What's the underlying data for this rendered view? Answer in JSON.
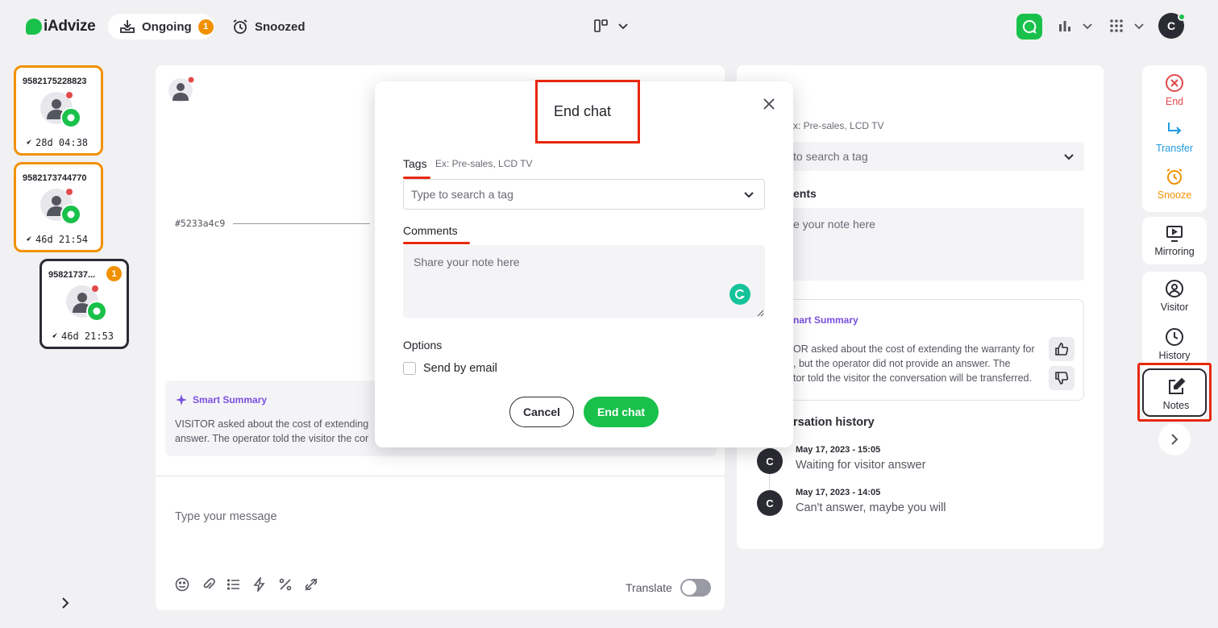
{
  "app": {
    "logo_text": "iAdvize"
  },
  "topbar": {
    "tabs": [
      {
        "label": "Ongoing",
        "badge": "1"
      },
      {
        "label": "Snoozed"
      }
    ],
    "avatar_initial": "C"
  },
  "conversations": [
    {
      "id": "9582175228823",
      "time": "28d 04:38",
      "status_color": "#f29100"
    },
    {
      "id": "9582173744770",
      "time": "46d 21:54",
      "status_color": "#f29100"
    },
    {
      "id": "95821737...",
      "time": "46d 21:53",
      "badge": "1",
      "status_color": "#2b2b33"
    }
  ],
  "chat": {
    "conversation_ref": "#5233a4c9",
    "smart_summary": {
      "title": "Smart Summary",
      "text_line1": "VISITOR asked about the cost of extending",
      "text_line2": "answer. The operator told the visitor the cor"
    },
    "message_placeholder": "Type your message",
    "translate_label": "Translate"
  },
  "right_panel": {
    "tags_hint": "x: Pre-sales, LCD TV",
    "tags_placeholder": "to search a tag",
    "comments_label": "ents",
    "comments_placeholder": "e your note here",
    "smart_summary": {
      "title": "nart Summary",
      "line1": "OR asked about the cost of extending the warranty for",
      "line2": ", but the operator did not provide an answer. The",
      "line3": "tor told the visitor the conversation will be transferred."
    },
    "history_title": "rsation history",
    "history": [
      {
        "initial": "C",
        "date": "May 17, 2023 - 15:05",
        "text": "Waiting for visitor answer"
      },
      {
        "initial": "C",
        "date": "May 17, 2023 - 14:05",
        "text": "Can't answer, maybe you will"
      }
    ]
  },
  "actions": {
    "end": "End",
    "transfer": "Transfer",
    "snooze": "Snooze",
    "mirroring": "Mirroring",
    "visitor": "Visitor",
    "history": "History",
    "notes": "Notes"
  },
  "modal": {
    "title": "End chat",
    "tags_label": "Tags",
    "tags_hint": "Ex: Pre-sales, LCD TV",
    "tags_placeholder": "Type to search a tag",
    "comments_label": "Comments",
    "comments_placeholder": "Share your note here",
    "options_label": "Options",
    "send_by_email_label": "Send by email",
    "cancel_label": "Cancel",
    "end_chat_label": "End chat"
  },
  "colors": {
    "brand_green": "#19c14b",
    "warning_orange": "#f29100",
    "highlight_red": "#e8280c",
    "summary_purple": "#7b4fe0",
    "end_red": "#e24a4a",
    "transfer_blue": "#1f9ae0"
  }
}
